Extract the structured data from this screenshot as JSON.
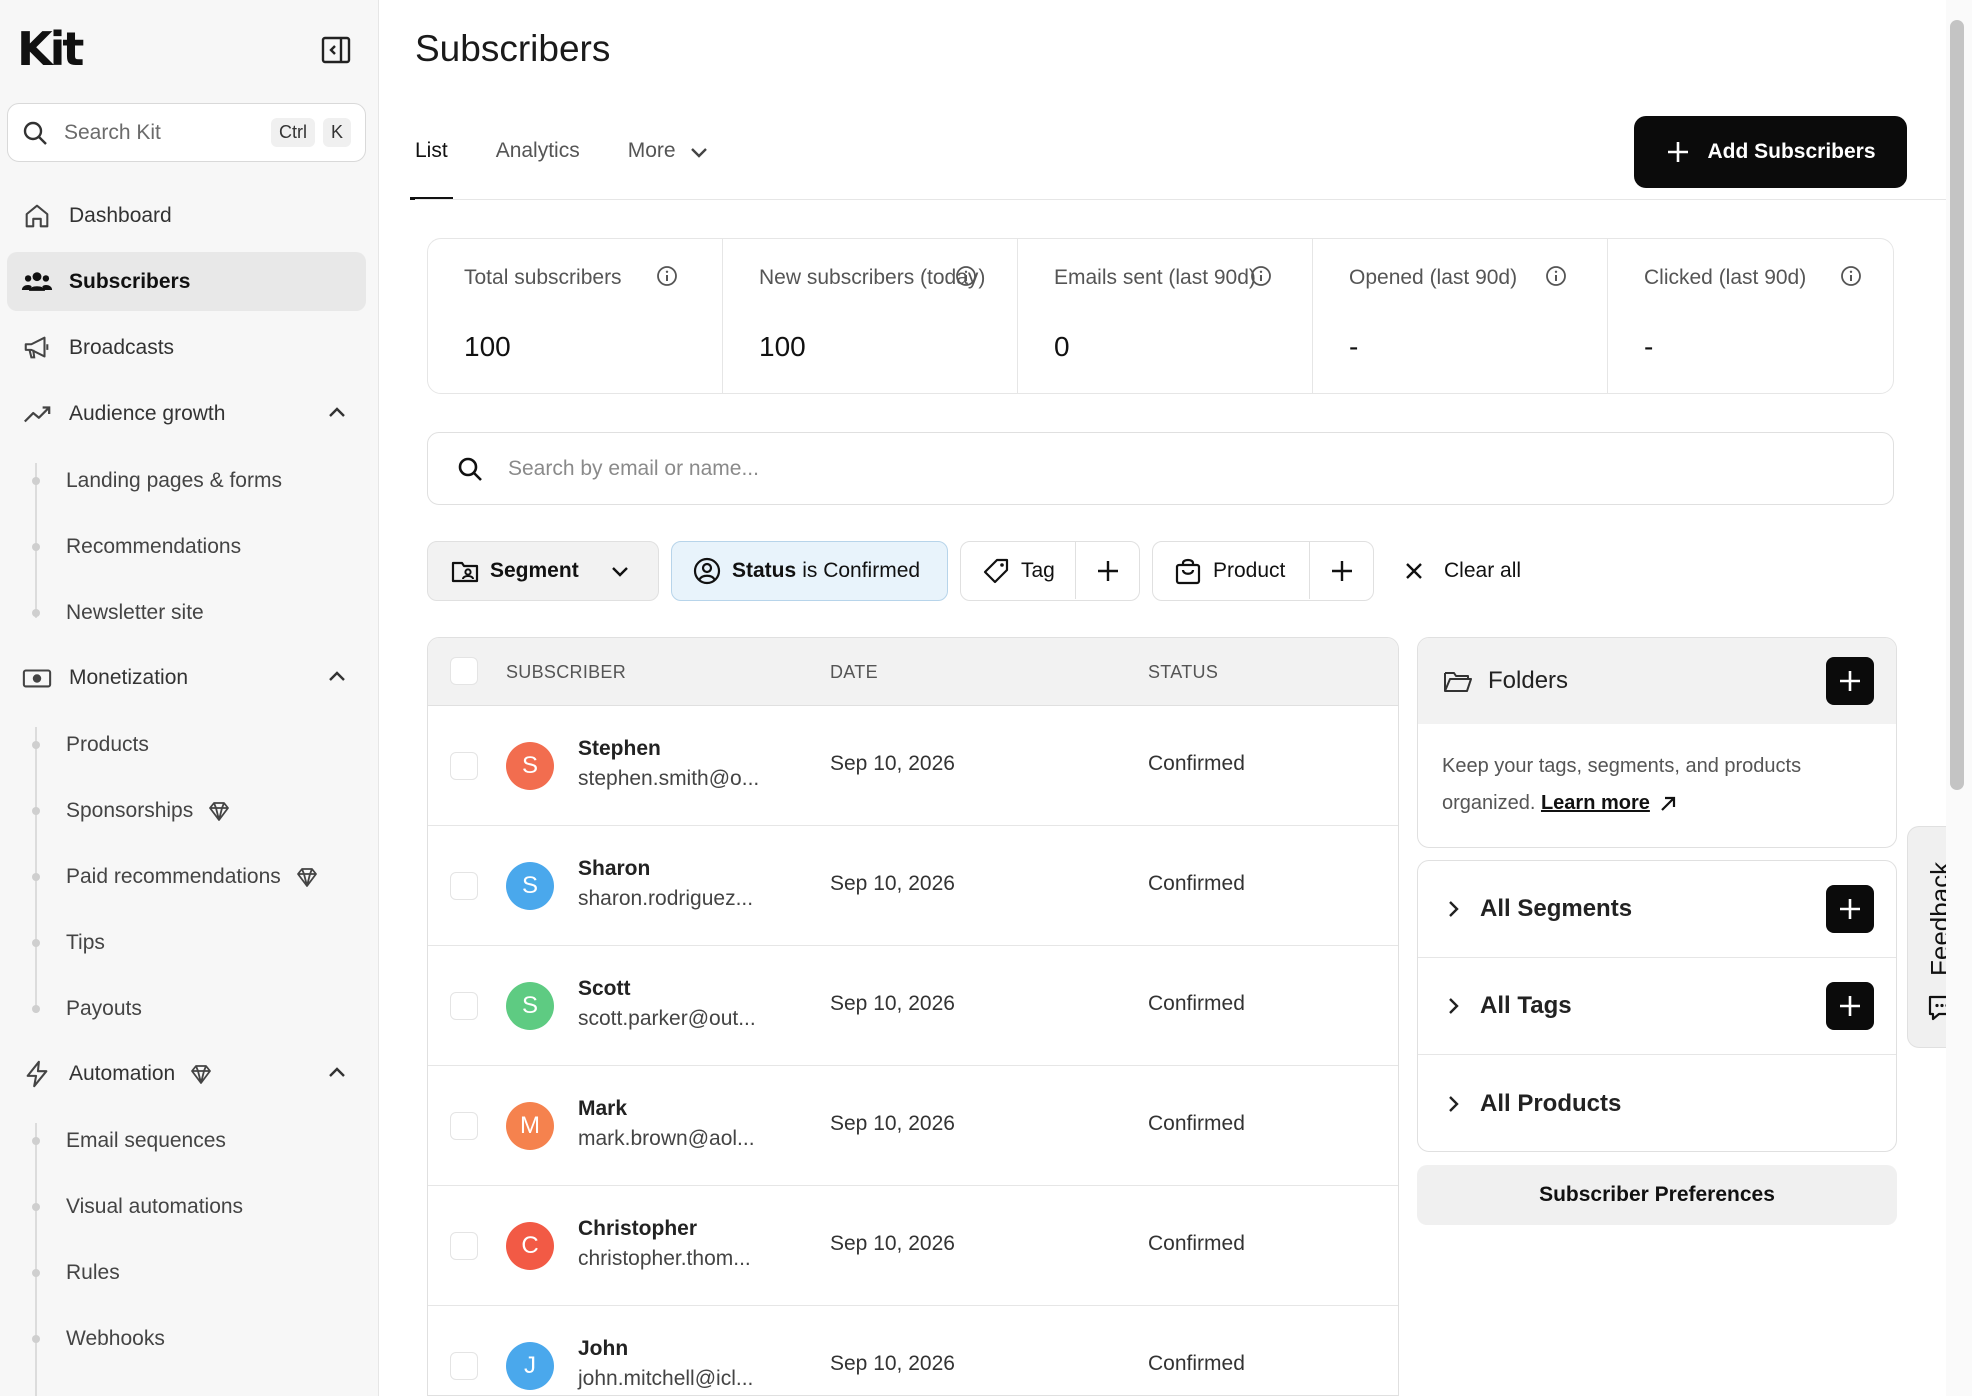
{
  "app": {
    "logo": "Kit"
  },
  "search": {
    "placeholder": "Search Kit",
    "shortcut_ctrl": "Ctrl",
    "shortcut_key": "K"
  },
  "sidebar": {
    "dashboard": "Dashboard",
    "subscribers": "Subscribers",
    "broadcasts": "Broadcasts",
    "audience_growth": "Audience growth",
    "audience_items": [
      "Landing pages & forms",
      "Recommendations",
      "Newsletter site"
    ],
    "monetization": "Monetization",
    "monetization_items": [
      "Products",
      "Sponsorships",
      "Paid recommendations",
      "Tips",
      "Payouts"
    ],
    "automation": "Automation",
    "automation_items": [
      "Email sequences",
      "Visual automations",
      "Rules",
      "Webhooks"
    ]
  },
  "main": {
    "title": "Subscribers",
    "tabs": [
      "List",
      "Analytics",
      "More"
    ],
    "add_button": "Add Subscribers"
  },
  "stats": [
    {
      "label": "Total subscribers",
      "value": "100"
    },
    {
      "label": "New subscribers (today)",
      "value": "100"
    },
    {
      "label": "Emails sent (last 90d)",
      "value": "0"
    },
    {
      "label": "Opened (last 90d)",
      "value": "-"
    },
    {
      "label": "Clicked (last 90d)",
      "value": "-"
    }
  ],
  "subscriber_search": {
    "placeholder": "Search by email or name..."
  },
  "filters": {
    "segment": "Segment",
    "status_prefix": "Status",
    "status_value": "is Confirmed",
    "tag": "Tag",
    "product": "Product",
    "clear_all": "Clear all"
  },
  "table": {
    "columns": [
      "SUBSCRIBER",
      "DATE",
      "STATUS"
    ],
    "rows": [
      {
        "initial": "S",
        "name": "Stephen",
        "email": "stephen.smith@o...",
        "date": "Sep 10, 2026",
        "status": "Confirmed",
        "color": "#f26d4f"
      },
      {
        "initial": "S",
        "name": "Sharon",
        "email": "sharon.rodriguez...",
        "date": "Sep 10, 2026",
        "status": "Confirmed",
        "color": "#4aa8ec"
      },
      {
        "initial": "S",
        "name": "Scott",
        "email": "scott.parker@out...",
        "date": "Sep 10, 2026",
        "status": "Confirmed",
        "color": "#5ecb82"
      },
      {
        "initial": "M",
        "name": "Mark",
        "email": "mark.brown@aol...",
        "date": "Sep 10, 2026",
        "status": "Confirmed",
        "color": "#f5824e"
      },
      {
        "initial": "C",
        "name": "Christopher",
        "email": "christopher.thom...",
        "date": "Sep 10, 2026",
        "status": "Confirmed",
        "color": "#f25a45"
      },
      {
        "initial": "J",
        "name": "John",
        "email": "john.mitchell@icl...",
        "date": "Sep 10, 2026",
        "status": "Confirmed",
        "color": "#4aa8ec"
      }
    ]
  },
  "folders": {
    "title": "Folders",
    "description": "Keep your tags, segments, and products organized.",
    "learn_more": "Learn more",
    "groups": [
      "All Segments",
      "All Tags",
      "All Products"
    ],
    "preferences_button": "Subscriber Preferences"
  },
  "feedback": {
    "label": "Feedback"
  }
}
